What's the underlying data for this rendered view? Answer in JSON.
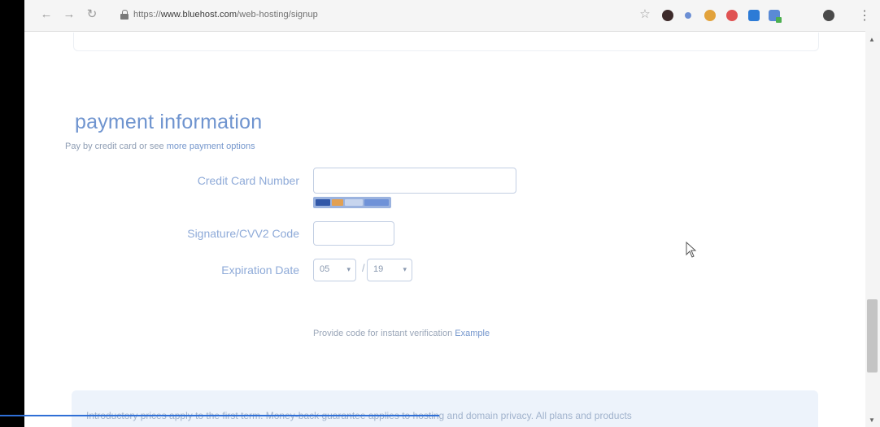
{
  "browser": {
    "url_prefix": "https://",
    "url_host": "www.bluehost.com",
    "url_path": "/web-hosting/signup",
    "back_icon": "←",
    "forward_icon": "→",
    "reload_icon": "↻",
    "bookmark_icon": "☆",
    "menu_icon": "⋮"
  },
  "payment": {
    "heading": "payment information",
    "subtext_prefix": "Pay by credit card or see ",
    "subtext_link": "more payment options",
    "card_number_label": "Credit Card Number",
    "card_number_value": "",
    "cvv_label": "Signature/CVV2 Code",
    "cvv_value": "",
    "expiration_label": "Expiration Date",
    "exp_month": "05",
    "exp_year": "19",
    "exp_separator": "/",
    "verify_text": "Provide code for instant verification ",
    "verify_link": "Example"
  },
  "notice": {
    "text": "Introductory prices apply to the first term. Money-back guarantee applies to hosting and domain privacy. All plans and products"
  },
  "colors": {
    "accent": "#6f94cf",
    "label": "#8eaad8",
    "link": "#7496cc"
  }
}
